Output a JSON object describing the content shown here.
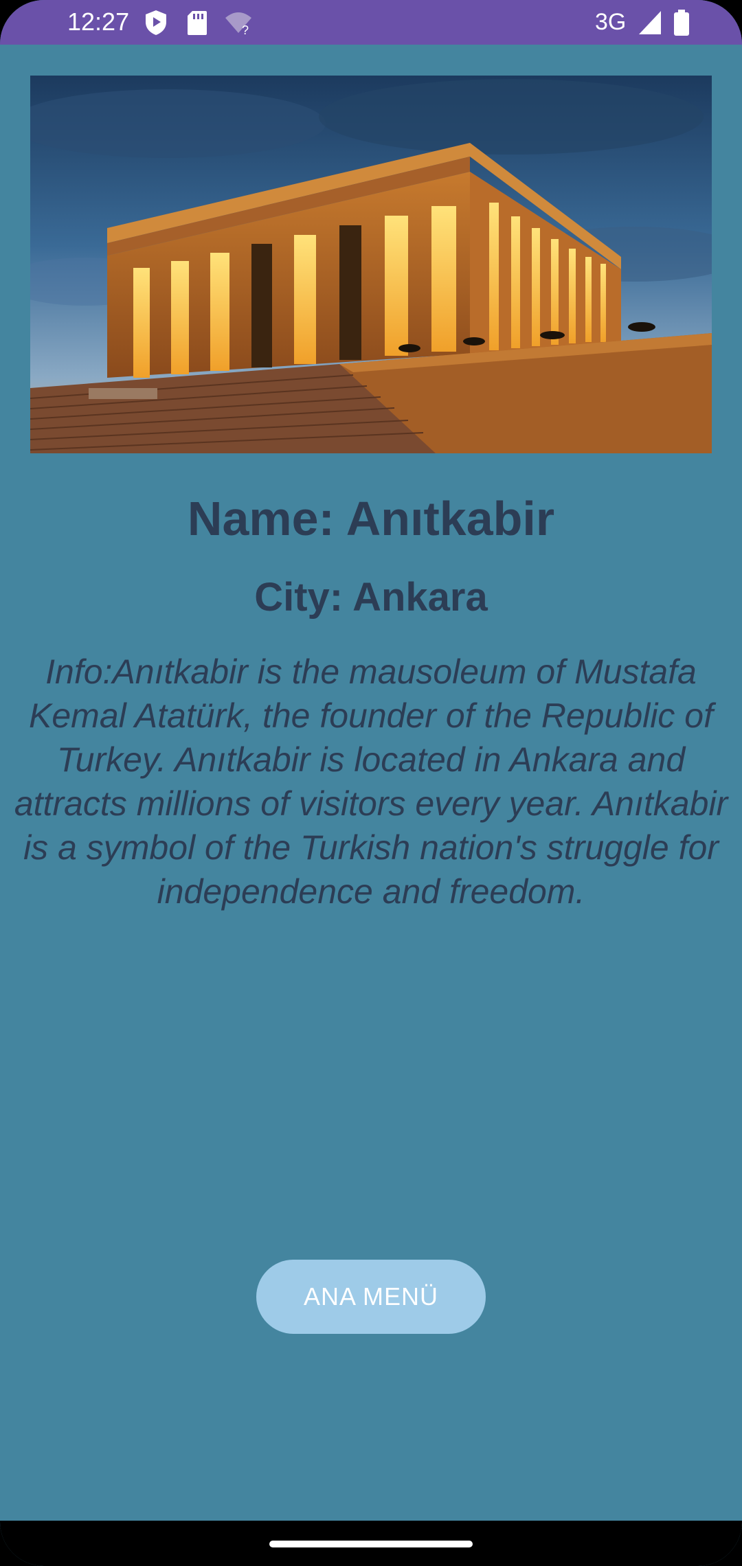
{
  "status_bar": {
    "time": "12:27",
    "network": "3G",
    "color": "#6a51a9",
    "icons": [
      "play-shield-icon",
      "sd-card-icon",
      "wifi-question-icon",
      "signal-icon",
      "battery-icon"
    ]
  },
  "hero_image": {
    "subject": "Anıtkabir mausoleum at dusk"
  },
  "place": {
    "name": "Name: Anıtkabir",
    "city": "City: Ankara",
    "info": "Info:Anıtkabir is the mausoleum of Mustafa Kemal Atatürk, the founder of the Republic of Turkey. Anıtkabir is located in Ankara and attracts millions of visitors every year. Anıtkabir is a symbol of the Turkish nation's struggle for independence and freedom."
  },
  "main_menu_button": {
    "label": "ANA MENÜ",
    "color": "#9ecbe8"
  },
  "colors": {
    "background": "#44859f",
    "text": "#2c3d55"
  }
}
